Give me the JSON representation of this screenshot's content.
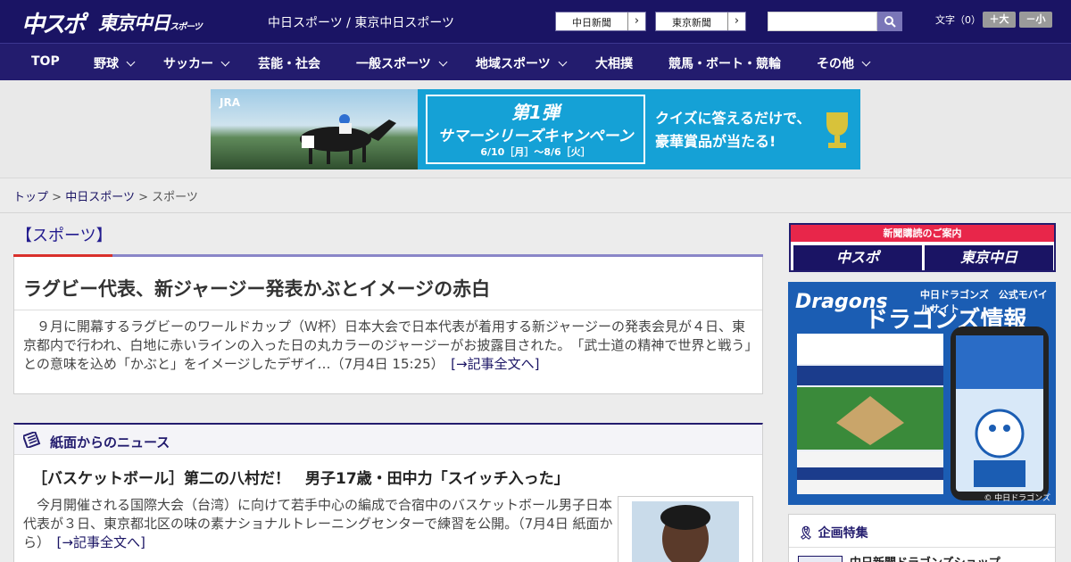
{
  "header": {
    "logo_chuspo": "中スポ",
    "logo_tokyo": "東京中日",
    "logo_tokyo_suffix": "スポーツ",
    "site_link": "中日スポーツ / 東京中日スポーツ",
    "paper_buttons": [
      "中日新聞",
      "東京新聞"
    ],
    "search": {
      "value": "",
      "placeholder": ""
    },
    "font_size_label": "文字（0）",
    "font_bigger": "＋大",
    "font_smaller": "－小"
  },
  "nav": {
    "items": [
      {
        "label": "TOP",
        "has_dropdown": false
      },
      {
        "label": "野球",
        "has_dropdown": true
      },
      {
        "label": "サッカー",
        "has_dropdown": true
      },
      {
        "label": "芸能・社会",
        "has_dropdown": false
      },
      {
        "label": "一般スポーツ",
        "has_dropdown": true
      },
      {
        "label": "地域スポーツ",
        "has_dropdown": true
      },
      {
        "label": "大相撲",
        "has_dropdown": false
      },
      {
        "label": "競馬・ボート・競輪",
        "has_dropdown": false
      },
      {
        "label": "その他",
        "has_dropdown": true
      }
    ]
  },
  "banner": {
    "jra": "JRA",
    "campaign_no": "第1弾",
    "campaign_title": "サマーシリーズキャンペーン",
    "campaign_dates": "6/10［月］～8/6［火］",
    "quiz_line1": "クイズに答えるだけで、",
    "quiz_line2": "豪華賞品が当たる!"
  },
  "breadcrumb": {
    "items": [
      "トップ",
      "中日スポーツ"
    ],
    "current": "スポーツ",
    "separator": ">"
  },
  "main": {
    "section_title": "【スポーツ】",
    "article": {
      "title": "ラグビー代表、新ジャージー発表かぶとイメージの赤白",
      "body": "９月に開幕するラグビーのワールドカップ（Ｗ杯）日本大会で日本代表が着用する新ジャージーの発表会見が４日、東京都内で行われ、白地に赤いラインの入った日の丸カラーのジャージーがお披露目された。　「武士道の精神で世界と戦う」との意味を込め「かぶと」をイメージしたデザイ…（7月4日 15:25）",
      "more": "[→記事全文へ]"
    },
    "news": {
      "heading": "紙面からのニュース",
      "title": "［バスケットボール］第二の八村だ！　男子17歳・田中力「スイッチ入った」",
      "body": "今月開催される国際大会（台湾）に向けて若手中心の編成で合宿中のバスケットボール男子日本代表が３日、東京都北区の味の素ナショナルトレーニングセンターで練習を公開。（7月4日 紙面から）",
      "more": "[→記事全文へ]"
    }
  },
  "sidebar": {
    "subscribe_heading": "新聞購読のご案内",
    "subscribe_chuspo": "中スポ",
    "subscribe_tokyo": "東京中日",
    "dragons_logo": "Dragons",
    "dragons_sub": "中日ドラゴンズ　公式モバイルサイト",
    "dragons_title": "ドラゴンズ情報",
    "dragons_copyright": "© 中日ドラゴンズ",
    "kikaku_heading": "企画特集",
    "kikaku_item": "中日新聞ドラゴンズショップ"
  },
  "colors": {
    "header_bg": "#1a1464",
    "nav_bg": "#231c6e",
    "accent_red": "#d9302b",
    "link": "#1a1464"
  }
}
